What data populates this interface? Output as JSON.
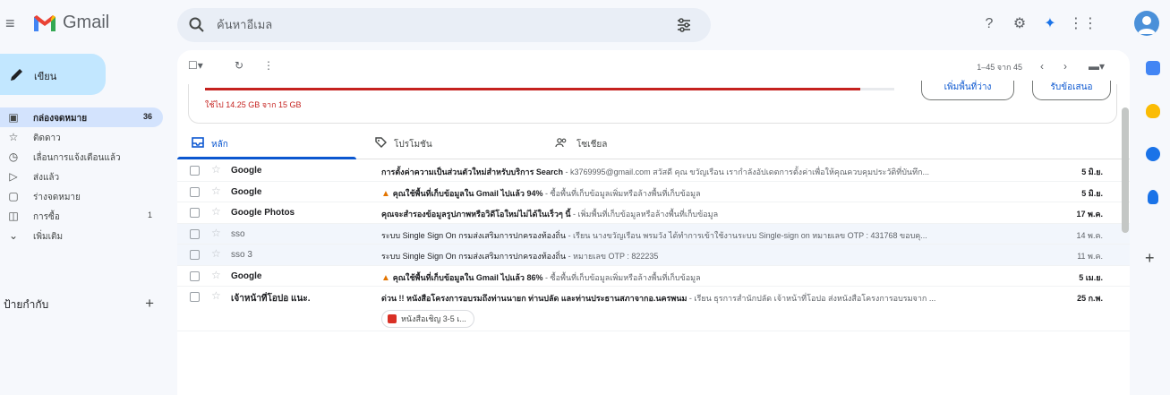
{
  "app": {
    "name": "Gmail"
  },
  "search": {
    "placeholder": "ค้นหาอีเมล"
  },
  "compose": {
    "label": "เขียน"
  },
  "nav": [
    {
      "icon": "inbox-icon",
      "label": "กล่องจดหมาย",
      "count": "36",
      "active": true
    },
    {
      "icon": "star-icon",
      "label": "ติดดาว",
      "count": ""
    },
    {
      "icon": "clock-icon",
      "label": "เลื่อนการแจ้งเตือนแล้ว",
      "count": ""
    },
    {
      "icon": "send-icon",
      "label": "ส่งแล้ว",
      "count": ""
    },
    {
      "icon": "draft-icon",
      "label": "ร่างจดหมาย",
      "count": ""
    },
    {
      "icon": "bag-icon",
      "label": "การซื้อ",
      "count": "1"
    },
    {
      "icon": "chevron-down-icon",
      "label": "เพิ่มเติม",
      "count": ""
    }
  ],
  "labels": {
    "title": "ป้ายกำกับ",
    "add": "+"
  },
  "toolbar": {
    "pagination": "1–45 จาก 45"
  },
  "storage": {
    "used_text": "ใช้ไป 14.25 GB จาก 15 GB",
    "used_fraction": 0.95,
    "button_1": "เพิ่มพื้นที่ว่าง",
    "button_2": "รับข้อเสนอ"
  },
  "tabs": [
    {
      "icon": "inbox-icon",
      "label": "หลัก",
      "active": true
    },
    {
      "icon": "tag-icon",
      "label": "โปรโมชัน"
    },
    {
      "icon": "people-icon",
      "label": "โซเชียล"
    }
  ],
  "emails": [
    {
      "sender": "Google",
      "subject": "การตั้งค่าความเป็นส่วนตัวใหม่สำหรับบริการ Search",
      "snippet": " - k3769995@gmail.com สวัสดี คุณ ขวัญเรือน เรากำลังอัปเดตการตั้งค่าเพื่อให้คุณควบคุมประวัติที่บันทึก...",
      "date": "5 มิ.ย.",
      "unread": true,
      "warning": false
    },
    {
      "sender": "Google",
      "subject": "คุณใช้พื้นที่เก็บข้อมูลใน Gmail ไปแล้ว 94%",
      "snippet": " - ซื้อพื้นที่เก็บข้อมูลเพิ่มหรือล้างพื้นที่เก็บข้อมูล",
      "date": "5 มิ.ย.",
      "unread": true,
      "warning": true
    },
    {
      "sender": "Google Photos",
      "subject": "คุณจะสำรองข้อมูลรูปภาพหรือวิดีโอใหม่ไม่ได้ในเร็วๆ นี้",
      "snippet": " - เพิ่มพื้นที่เก็บข้อมูลหรือล้างพื้นที่เก็บข้อมูล",
      "date": "17 พ.ค.",
      "unread": true,
      "warning": false
    },
    {
      "sender": "sso",
      "subject": "ระบบ Single Sign On กรมส่งเสริมการปกครองท้องถิ่น",
      "snippet": " - เรียน นางขวัญเรือน พรมวัง ได้ทำการเข้าใช้งานระบบ Single-sign on หมายเลข OTP : 431768 ขอบคุ...",
      "date": "14 พ.ค.",
      "unread": false,
      "warning": false
    },
    {
      "sender": "sso 3",
      "subject": "ระบบ Single Sign On กรมส่งเสริมการปกครองท้องถิ่น",
      "snippet": " - หมายเลข OTP : 822235",
      "date": "11 พ.ค.",
      "unread": false,
      "warning": false
    },
    {
      "sender": "Google",
      "subject": "คุณใช้พื้นที่เก็บข้อมูลใน Gmail ไปแล้ว 86%",
      "snippet": " - ซื้อพื้นที่เก็บข้อมูลเพิ่มหรือล้างพื้นที่เก็บข้อมูล",
      "date": "5 เม.ย.",
      "unread": true,
      "warning": true
    },
    {
      "sender": "เจ้าหน้าที่โอปอ แนะ.",
      "subject": "ด่วน !! หนังสือโครงการอบรมถึงท่านนายก ท่านปลัด และท่านประธานสภาจากอ.นครพนม",
      "snippet": " - เรียน ธุรการสำนักปลัด เจ้าหน้าที่โอปอ ส่งหนังสือโครงการอบรมจาก ...",
      "date": "25 ก.พ.",
      "unread": true,
      "warning": false,
      "attachment": "หนังสือเชิญ 3-5 เ..."
    }
  ],
  "colors": {
    "accent": "#0b57d0",
    "storage_warning": "#c5221f",
    "nav_active": "#d3e3fd",
    "compose": "#c2e7ff"
  }
}
